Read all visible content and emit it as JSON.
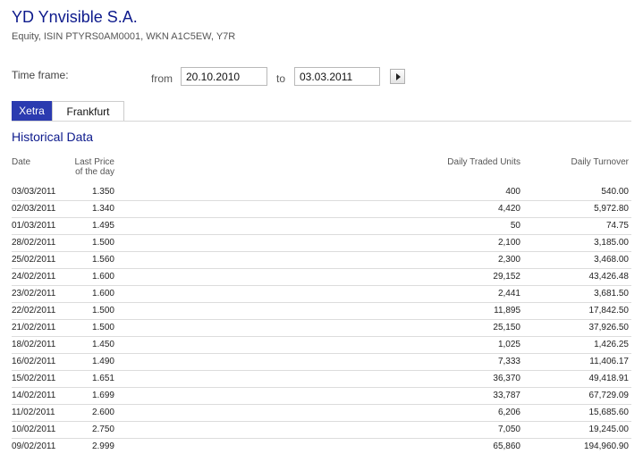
{
  "header": {
    "title": "YD Ynvisible S.A.",
    "subtitle": "Equity, ISIN PTYRS0AM0001, WKN A1C5EW, Y7R"
  },
  "time_frame": {
    "label": "Time frame:",
    "from_label": "from",
    "from_value": "20.10.2010",
    "to_label": "to",
    "to_value": "03.03.2011",
    "go_icon": "play-arrow-icon"
  },
  "tabs": [
    {
      "label": "Xetra",
      "active": true
    },
    {
      "label": "Frankfurt",
      "active": false
    }
  ],
  "section_title": "Historical Data",
  "table": {
    "columns": {
      "date": "Date",
      "price_line1": "Last Price",
      "price_line2": "of the day",
      "units": "Daily Traded Units",
      "turnover": "Daily Turnover"
    },
    "rows": [
      {
        "date": "03/03/2011",
        "price": "1.350",
        "units": "400",
        "turnover": "540.00"
      },
      {
        "date": "02/03/2011",
        "price": "1.340",
        "units": "4,420",
        "turnover": "5,972.80"
      },
      {
        "date": "01/03/2011",
        "price": "1.495",
        "units": "50",
        "turnover": "74.75"
      },
      {
        "date": "28/02/2011",
        "price": "1.500",
        "units": "2,100",
        "turnover": "3,185.00"
      },
      {
        "date": "25/02/2011",
        "price": "1.560",
        "units": "2,300",
        "turnover": "3,468.00"
      },
      {
        "date": "24/02/2011",
        "price": "1.600",
        "units": "29,152",
        "turnover": "43,426.48"
      },
      {
        "date": "23/02/2011",
        "price": "1.600",
        "units": "2,441",
        "turnover": "3,681.50"
      },
      {
        "date": "22/02/2011",
        "price": "1.500",
        "units": "11,895",
        "turnover": "17,842.50"
      },
      {
        "date": "21/02/2011",
        "price": "1.500",
        "units": "25,150",
        "turnover": "37,926.50"
      },
      {
        "date": "18/02/2011",
        "price": "1.450",
        "units": "1,025",
        "turnover": "1,426.25"
      },
      {
        "date": "16/02/2011",
        "price": "1.490",
        "units": "7,333",
        "turnover": "11,406.17"
      },
      {
        "date": "15/02/2011",
        "price": "1.651",
        "units": "36,370",
        "turnover": "49,418.91"
      },
      {
        "date": "14/02/2011",
        "price": "1.699",
        "units": "33,787",
        "turnover": "67,729.09"
      },
      {
        "date": "11/02/2011",
        "price": "2.600",
        "units": "6,206",
        "turnover": "15,685.60"
      },
      {
        "date": "10/02/2011",
        "price": "2.750",
        "units": "7,050",
        "turnover": "19,245.00"
      },
      {
        "date": "09/02/2011",
        "price": "2.999",
        "units": "65,860",
        "turnover": "194,960.90"
      }
    ]
  },
  "colors": {
    "title": "#0d1a8c",
    "tab_active_bg": "#2b3bb0",
    "row_divider": "#dcdcdc"
  }
}
